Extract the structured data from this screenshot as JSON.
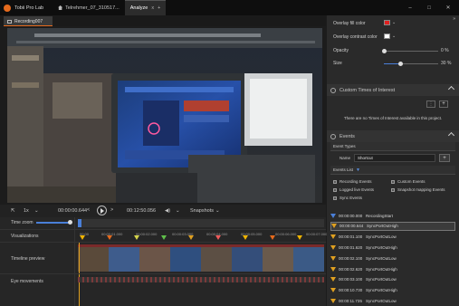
{
  "titlebar": {
    "app_name": "Tobii Pro Lab",
    "tab_home": "Telrehmer_07_310517...",
    "tab_active": "Analyze",
    "tab_active_close": "x",
    "tab_add": "+",
    "win_min": "–",
    "win_max": "□",
    "win_close": "✕"
  },
  "recording_tab": "Recording007",
  "controls": {
    "speed": "1x",
    "current_time": "00:00:00.644",
    "total_time": "00:12:50.056",
    "snapshots": "Snapshots"
  },
  "timeline": {
    "time_zoom": "Time zoom",
    "visualizations": "Visualizations",
    "timeline_preview": "Timeline preview",
    "eye_movements": "Eye movements",
    "ticks": [
      "00:00",
      "00:00:01.000",
      "00:00:02.000",
      "00:00:03.000",
      "00:00:04.000",
      "00:00:05.000",
      "00:00:06.000",
      "00:00:07.000"
    ],
    "marker_colors": [
      "#f0b400",
      "#e56a1d",
      "#d4d44a",
      "#5fbf4a",
      "#e0a020",
      "#f05a5a",
      "#f0b400",
      "#e56a1d",
      "#f0b400"
    ]
  },
  "right_panel": {
    "overlay_fill_color": "Overlay fill color",
    "overlay_contrast_color": "Overlay contrast color",
    "opacity_label": "Opacity",
    "opacity_value": "0 %",
    "size_label": "Size",
    "size_value": "30 %",
    "size_fraction": 0.3,
    "fill_color": "#e02020",
    "contrast_color": "#ffffff",
    "custom_toi_title": "Custom Times of Interest",
    "custom_toi_empty": "There are no Times of Interest available in this project.",
    "events_title": "Events",
    "event_types": "Event Types",
    "name_label": "Name",
    "name_value": "Shortcut",
    "events_list": "Events List",
    "checkboxes": [
      "Recording Events",
      "Logged live Events",
      "Sync Events",
      "Custom Events",
      "Snapshot mapping Events"
    ],
    "events": [
      {
        "time": "00:00:00.000",
        "name": "RecordingStart"
      },
      {
        "time": "00:00:00.644",
        "name": "SyncPortOutHigh"
      },
      {
        "time": "00:00:01.100",
        "name": "SyncPortOutLow"
      },
      {
        "time": "00:00:01.620",
        "name": "SyncPortOutHigh"
      },
      {
        "time": "00:00:02.100",
        "name": "SyncPortOutLow"
      },
      {
        "time": "00:00:02.620",
        "name": "SyncPortOutHigh"
      },
      {
        "time": "00:00:03.100",
        "name": "SyncPortOutLow"
      },
      {
        "time": "00:00:10.730",
        "name": "SyncPortOutHigh"
      },
      {
        "time": "00:00:11.735",
        "name": "SyncPortOutLow"
      }
    ]
  }
}
